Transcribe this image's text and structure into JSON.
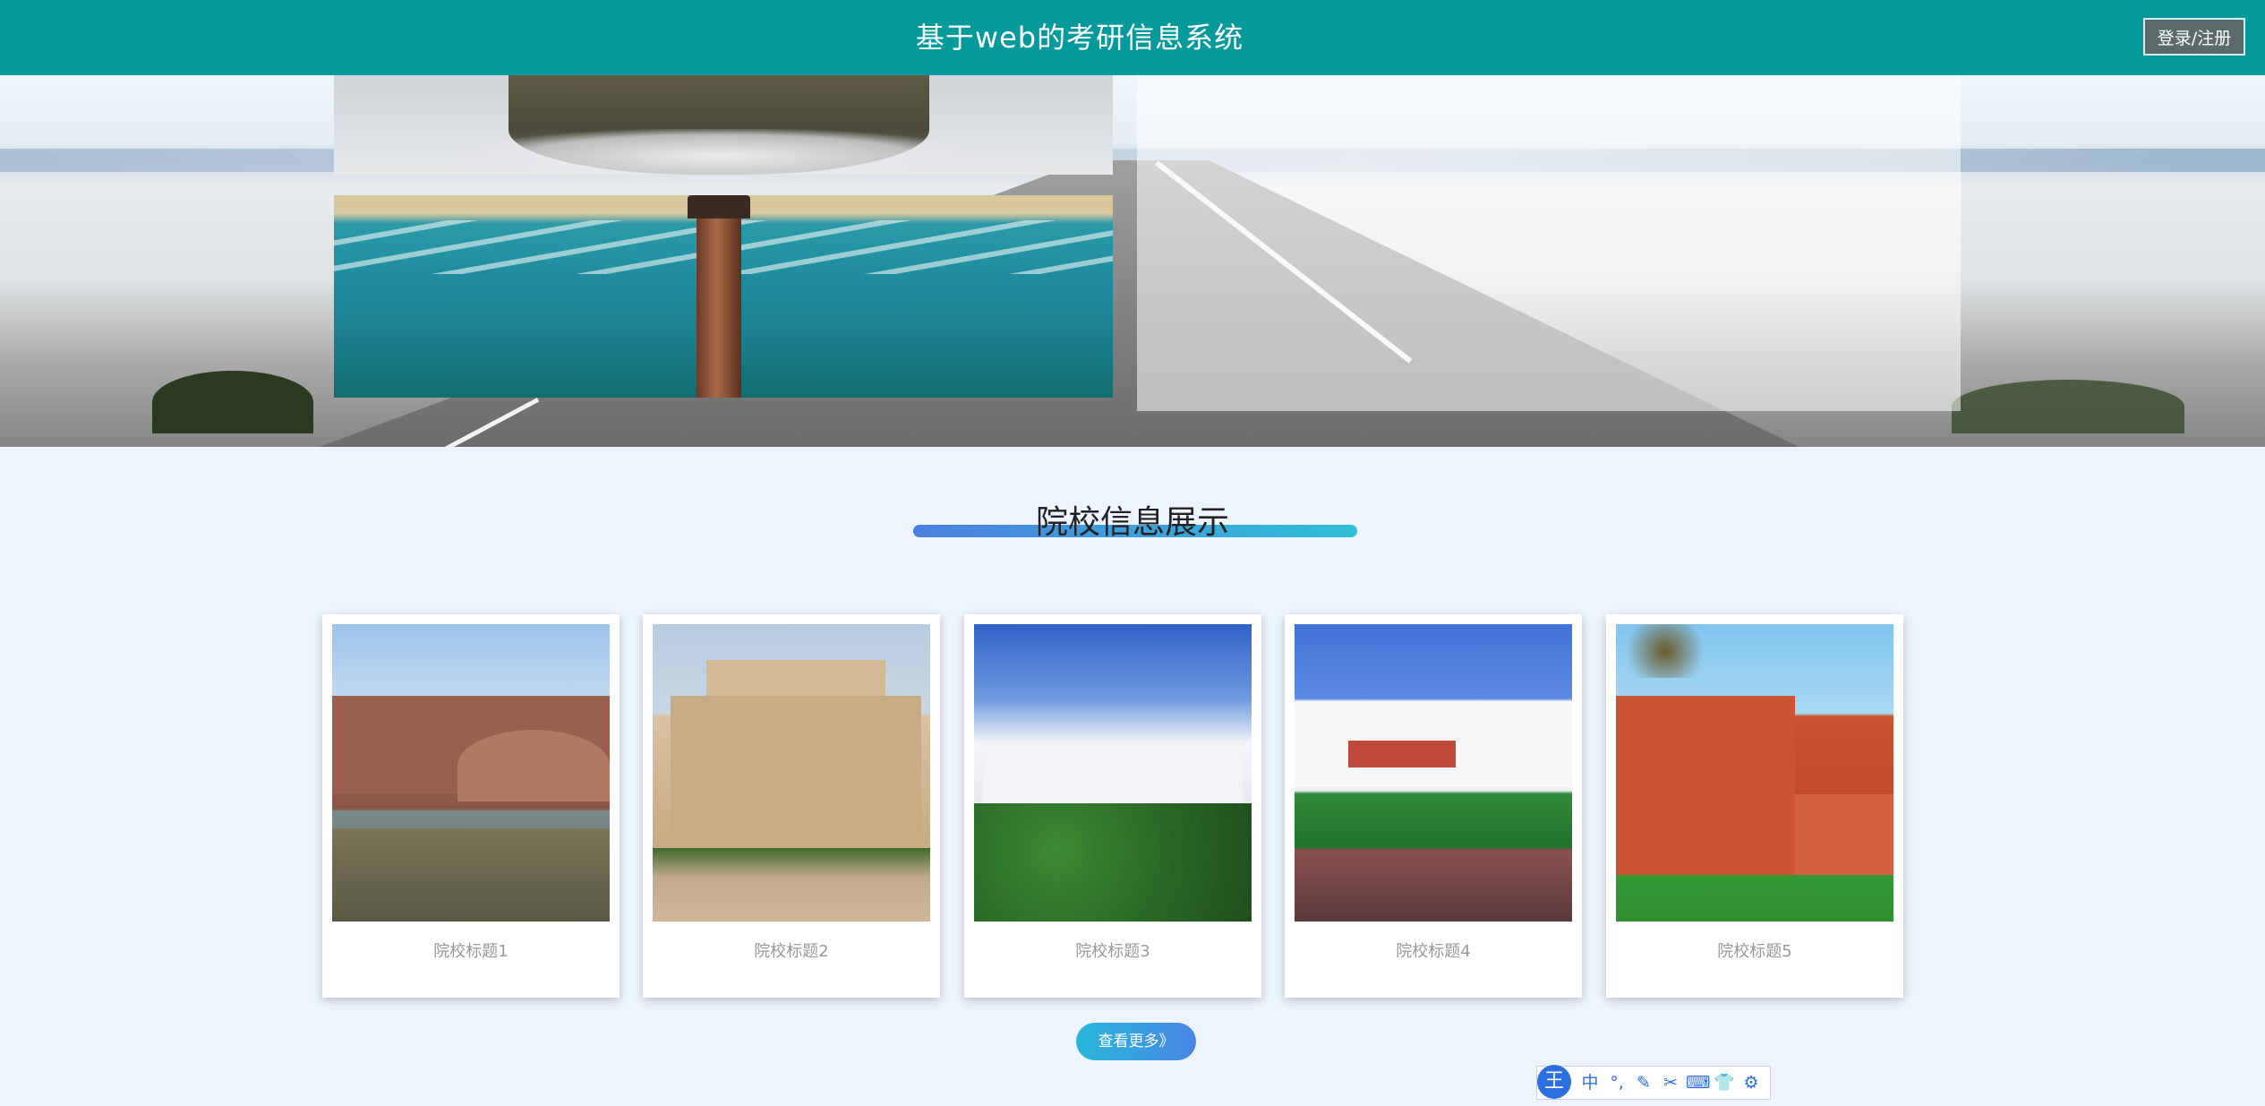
{
  "header": {
    "site_title": "基于web的考研信息系统",
    "login_label": "登录/注册"
  },
  "section": {
    "title": "院校信息展示"
  },
  "cards": [
    {
      "caption": "院校标题1"
    },
    {
      "caption": "院校标题2"
    },
    {
      "caption": "院校标题3"
    },
    {
      "caption": "院校标题4"
    },
    {
      "caption": "院校标题5"
    }
  ],
  "more_button": {
    "label": "查看更多》"
  },
  "ime_toolbar": {
    "logo": "王",
    "items": [
      "中",
      "°,",
      "✎",
      "✂",
      "⌨",
      "👕",
      "⚙"
    ]
  },
  "colors": {
    "header_bg": "#04999a",
    "page_bg": "#eef4fd",
    "accent_start": "#4d7fe0",
    "accent_end": "#2ec0d6"
  }
}
